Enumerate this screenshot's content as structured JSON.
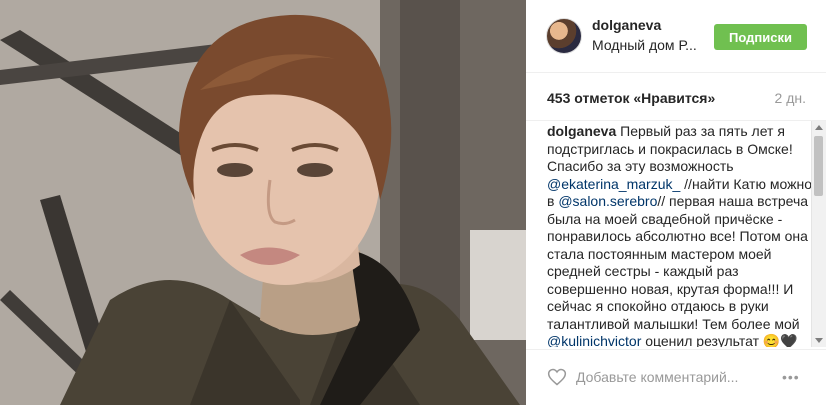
{
  "post": {
    "username": "dolganeva",
    "subtitle": "Модный дом Р...",
    "follow_label": "Подписки",
    "likes": "453 отметок «Нравится»",
    "time": "2 дн."
  },
  "caption": {
    "username": "dolganeva",
    "text_1": "Первый раз за пять лет я подстриглась и покрасилась в Омске! Спасибо за эту возможность",
    "mention_1": "@ekaterina_marzuk_",
    "text_2": "//найти Катю можно в",
    "mention_2": "@salon.serebro",
    "text_3": "// первая наша встреча была на моей свадебной причёске - понравилось абсолютно все! Потом она стала постоянным мастером моей средней сестры - каждый раз совершенно новая, крутая форма!!! И сейчас я спокойно отдаюсь в руки талантливой малышки! Тем более мой",
    "mention_3": "@kulinichvictor",
    "text_4": "оценил результат 😊🖤"
  },
  "footer": {
    "comment_placeholder": "Добавьте комментарий...",
    "more_label": "•••"
  },
  "colors": {
    "follow_button": "#70c050",
    "mention": "#003569",
    "muted": "#999999"
  },
  "icons": [
    "heart-icon",
    "more-icon",
    "scroll-up-icon",
    "scroll-down-icon"
  ]
}
